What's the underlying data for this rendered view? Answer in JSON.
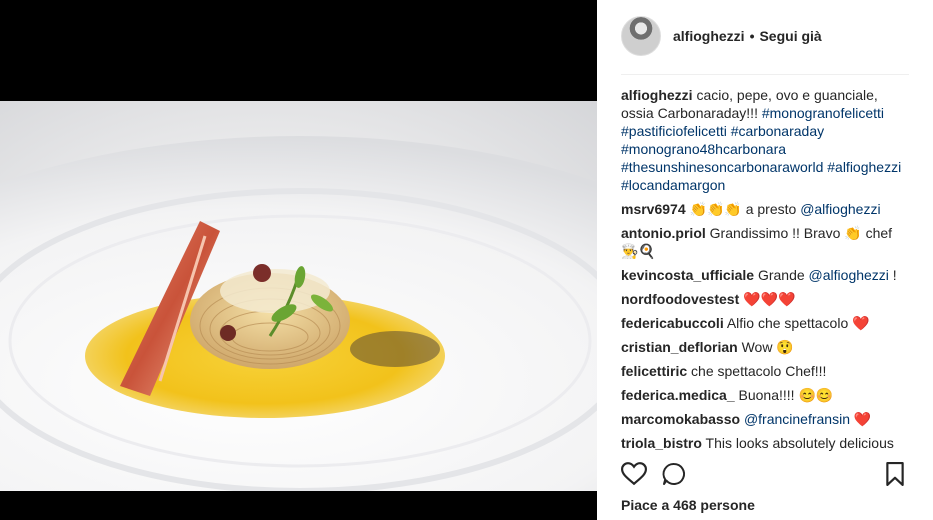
{
  "post": {
    "username": "alfioghezzi",
    "separator": "•",
    "follow_label": "Segui già",
    "likes_text": "Piace a 468 persone"
  },
  "comments": [
    {
      "user": "alfioghezzi",
      "text": " cacio, pepe, ovo e guanciale, ossia Carbonaraday!!! ",
      "tags": "#monogranofelicetti #pastificiofelicetti #carbonaraday #monograno48hcarbonara #thesunshinesoncarbonaraworld #alfioghezzi #locandamargon"
    },
    {
      "user": "msrv6974",
      "text": " 👏👏👏 a presto ",
      "tags": "@alfioghezzi"
    },
    {
      "user": "antonio.priol",
      "text": " Grandissimo !! Bravo 👏 chef 👨‍🍳🍳",
      "tags": ""
    },
    {
      "user": "kevincosta_ufficiale",
      "text": " Grande ",
      "tags": "@alfioghezzi",
      "after": " !"
    },
    {
      "user": "nordfoodovestest",
      "text": " ❤️❤️❤️",
      "tags": ""
    },
    {
      "user": "federicabuccoli",
      "text": " Alfio che spettacolo ❤️",
      "tags": ""
    },
    {
      "user": "cristian_deflorian",
      "text": " Wow 😲",
      "tags": ""
    },
    {
      "user": "felicettiric",
      "text": " che spettacolo Chef!!!",
      "tags": ""
    },
    {
      "user": "federica.medica_",
      "text": " Buona!!!! 😊😊",
      "tags": ""
    },
    {
      "user": "marcomokabasso",
      "text": " ",
      "tags": "@francinefransin",
      "after": " ❤️"
    },
    {
      "user": "triola_bistro",
      "text": " This looks absolutely delicious",
      "tags": ""
    }
  ],
  "icons": {
    "like": "heart-icon",
    "comment": "comment-icon",
    "save": "bookmark-icon"
  },
  "colors": {
    "link": "#003569",
    "text": "#262626",
    "sauce": "#f2c21b"
  }
}
